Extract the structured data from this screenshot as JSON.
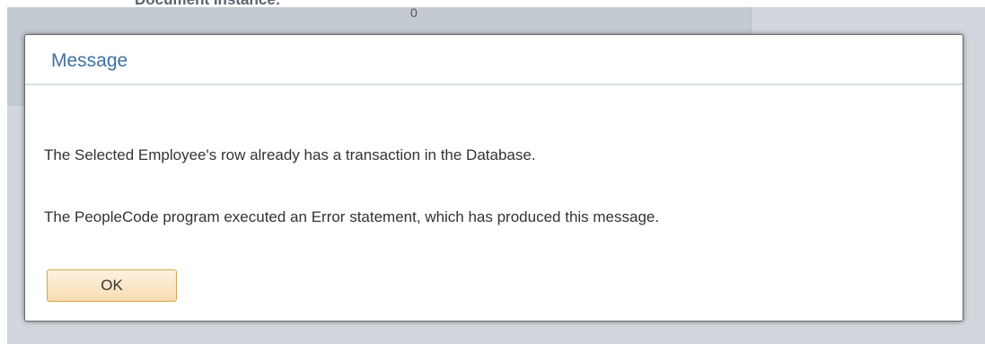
{
  "background": {
    "partial_label": "Document Instance:",
    "partial_value": "0"
  },
  "dialog": {
    "title": "Message",
    "messages": [
      "The Selected Employee's row already has a transaction in the Database.",
      "The PeopleCode program executed an Error statement, which has produced this message."
    ],
    "ok_label": "OK"
  },
  "colors": {
    "title": "#3f6fa3",
    "button_border": "#d5a54f",
    "button_fill": "#f8ddb0",
    "overlay": "#d2d7dd"
  }
}
